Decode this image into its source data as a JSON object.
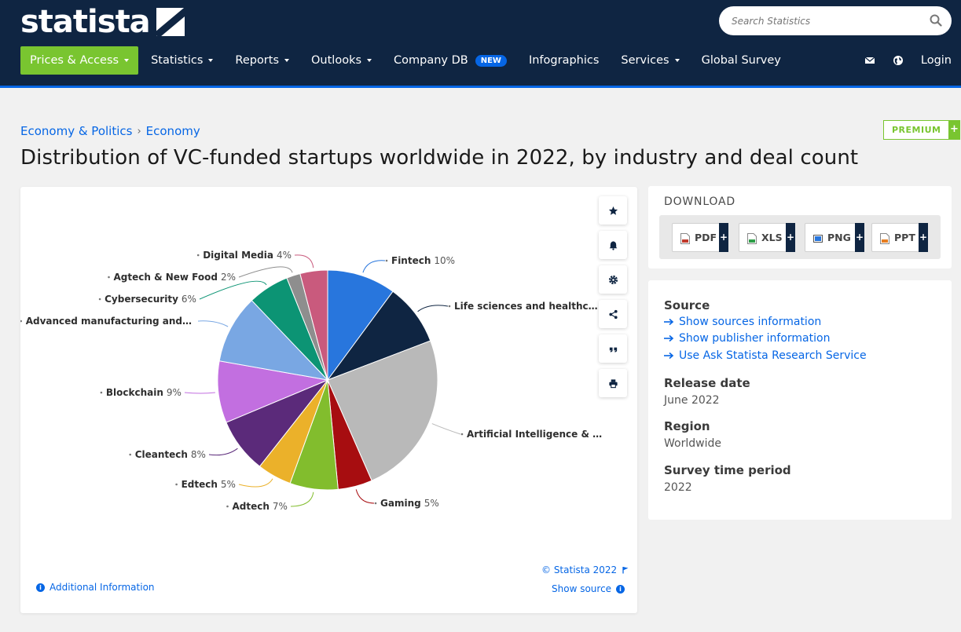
{
  "header": {
    "logo_text": "statista",
    "search_placeholder": "Search Statistics",
    "nav": [
      {
        "label": "Prices & Access",
        "caret": true
      },
      {
        "label": "Statistics",
        "caret": true
      },
      {
        "label": "Reports",
        "caret": true
      },
      {
        "label": "Outlooks",
        "caret": true
      },
      {
        "label": "Company DB",
        "caret": false,
        "badge": "NEW"
      },
      {
        "label": "Infographics",
        "caret": false
      },
      {
        "label": "Services",
        "caret": true
      },
      {
        "label": "Global Survey",
        "caret": false
      }
    ],
    "login_label": "Login",
    "icons": [
      "mail-icon",
      "globe-icon"
    ]
  },
  "breadcrumb": {
    "items": [
      "Economy & Politics",
      "Economy"
    ],
    "separator": "›"
  },
  "premium": {
    "label": "PREMIUM",
    "plus": "+"
  },
  "page_title": "Distribution of VC-funded startups worldwide in 2022, by industry and deal count",
  "chart_tools": [
    "star-icon",
    "bell-icon",
    "gear-icon",
    "share-icon",
    "quote-icon",
    "print-icon"
  ],
  "chart_footer": {
    "copyright": "© Statista 2022",
    "show_source": "Show source",
    "additional_info": "Additional Information"
  },
  "chart_data": {
    "type": "pie",
    "title": "",
    "categories": [
      "Fintech",
      "Life sciences and healthc…",
      "Artificial Intelligence & …",
      "Gaming",
      "Adtech",
      "Edtech",
      "Cleantech",
      "Blockchain",
      "Advanced manufacturing and…",
      "Cybersecurity",
      "Agtech & New Food",
      "Digital Media"
    ],
    "values": [
      10,
      9,
      24,
      5,
      7,
      5,
      8,
      9,
      10,
      6,
      2,
      4
    ],
    "labels": [
      "10%",
      "",
      "",
      "5%",
      "7%",
      "5%",
      "8%",
      "9%",
      "",
      "6%",
      "2%",
      "4%"
    ],
    "colors": [
      "#2876dd",
      "#0f2542",
      "#b9b9b9",
      "#a70d10",
      "#82bd2d",
      "#ebb12a",
      "#5b2a7a",
      "#c26fe0",
      "#79a7e3",
      "#0c9474",
      "#8e8e8e",
      "#c95a7d"
    ]
  },
  "download": {
    "title": "DOWNLOAD",
    "buttons": [
      {
        "label": "PDF",
        "color": "#c0392b"
      },
      {
        "label": "XLS",
        "color": "#2e9e48"
      },
      {
        "label": "PNG",
        "color": "#2876dd"
      },
      {
        "label": "PPT",
        "color": "#e67e22"
      }
    ]
  },
  "meta": {
    "source_heading": "Source",
    "source_links": [
      "Show sources information",
      "Show publisher information",
      "Use Ask Statista Research Service"
    ],
    "release_heading": "Release date",
    "release_value": "June 2022",
    "region_heading": "Region",
    "region_value": "Worldwide",
    "survey_heading": "Survey time period",
    "survey_value": "2022"
  }
}
